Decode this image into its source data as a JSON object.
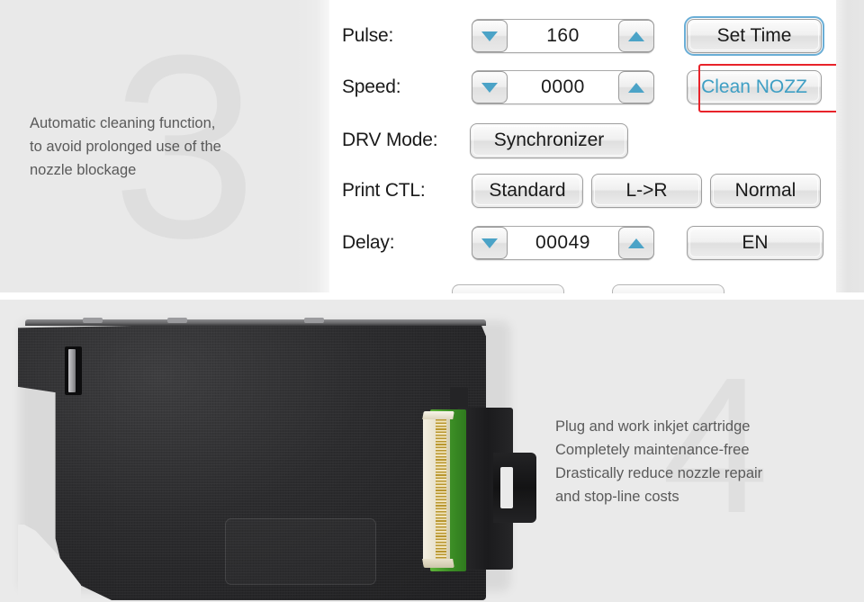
{
  "top": {
    "feature_number": "3",
    "description": "Automatic cleaning function,\nto avoid prolonged use of the\nnozzle blockage",
    "panel": {
      "rows": {
        "pulse": {
          "label": "Pulse:",
          "value": "160",
          "decrement_icon": "triangle-down-icon",
          "increment_icon": "triangle-up-icon",
          "action_label": "Set Time"
        },
        "speed": {
          "label": "Speed:",
          "value": "0000",
          "decrement_icon": "triangle-down-icon",
          "increment_icon": "triangle-up-icon",
          "action_label": "Clean NOZZ"
        },
        "drv_mode": {
          "label": "DRV Mode:",
          "value": "Synchronizer"
        },
        "print_ctl": {
          "label": "Print CTL:",
          "options": [
            "Standard",
            "L->R",
            "Normal"
          ]
        },
        "delay": {
          "label": "Delay:",
          "value": "00049",
          "decrement_icon": "triangle-down-icon",
          "increment_icon": "triangle-up-icon",
          "action_label": "EN"
        }
      }
    },
    "colors": {
      "accent_arrow": "#4ba3c7",
      "focus_ring": "#6aaed6",
      "highlight_box": "#e8232a",
      "highlighted_text": "#4ba3c7",
      "panel_bg": "#e9e9e9"
    }
  },
  "bottom": {
    "feature_number": "4",
    "description": "Plug and work inkjet cartridge\nCompletely maintenance-free\nDrastically reduce nozzle repair\nand stop-line costs",
    "product_image_name": "inkjet-cartridge-photo",
    "colors": {
      "section_bg": "#eaeaea",
      "cartridge_body": "#2c2c2e",
      "connector_pcb": "#3d8f26",
      "connector_pins": "#b9962f"
    }
  }
}
